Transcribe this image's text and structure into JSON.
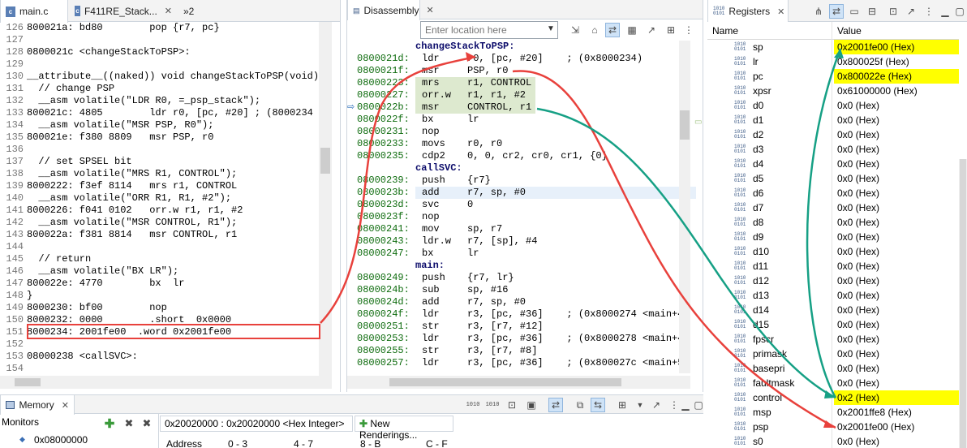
{
  "editor": {
    "tabs": [
      {
        "label": "main.c",
        "icon": "c-file-icon"
      },
      {
        "label": "F411RE_Stack...",
        "icon": "c-file-icon"
      },
      {
        "label": "»2",
        "icon": "more-tabs-icon"
      }
    ],
    "lines": [
      {
        "num": "126",
        "text": "800021a: bd80        pop {r7, pc}"
      },
      {
        "num": "127",
        "text": ""
      },
      {
        "num": "128",
        "text": "0800021c <changeStackToPSP>:"
      },
      {
        "num": "129",
        "text": ""
      },
      {
        "num": "130",
        "text": "__attribute__((naked)) void changeStackToPSP(void)"
      },
      {
        "num": "131",
        "text": "  // change PSP"
      },
      {
        "num": "132",
        "text": "  __asm volatile(\"LDR R0, =_psp_stack\");"
      },
      {
        "num": "133",
        "text": "800021c: 4805        ldr r0, [pc, #20] ; (8000234"
      },
      {
        "num": "134",
        "text": "  __asm volatile(\"MSR PSP, R0\");"
      },
      {
        "num": "135",
        "text": "800021e: f380 8809   msr PSP, r0"
      },
      {
        "num": "136",
        "text": ""
      },
      {
        "num": "137",
        "text": "  // set SPSEL bit"
      },
      {
        "num": "138",
        "text": "  __asm volatile(\"MRS R1, CONTROL\");"
      },
      {
        "num": "139",
        "text": "8000222: f3ef 8114   mrs r1, CONTROL"
      },
      {
        "num": "140",
        "text": "  __asm volatile(\"ORR R1, R1, #2\");"
      },
      {
        "num": "141",
        "text": "8000226: f041 0102   orr.w r1, r1, #2"
      },
      {
        "num": "142",
        "text": "  __asm volatile(\"MSR CONTROL, R1\");"
      },
      {
        "num": "143",
        "text": "800022a: f381 8814   msr CONTROL, r1"
      },
      {
        "num": "144",
        "text": ""
      },
      {
        "num": "145",
        "text": "  // return"
      },
      {
        "num": "146",
        "text": "  __asm volatile(\"BX LR\");"
      },
      {
        "num": "147",
        "text": "800022e: 4770        bx  lr"
      },
      {
        "num": "148",
        "text": "}"
      },
      {
        "num": "149",
        "text": "8000230: bf00        nop"
      },
      {
        "num": "150",
        "text": "8000232: 0000        .short  0x0000"
      },
      {
        "num": "151",
        "text": "8000234: 2001fe00  .word 0x2001fe00"
      },
      {
        "num": "152",
        "text": ""
      },
      {
        "num": "153",
        "text": "08000238 <callSVC>:"
      },
      {
        "num": "154",
        "text": ""
      }
    ]
  },
  "disassembly": {
    "tab_label": "Disassembly",
    "location_placeholder": "Enter location here",
    "lines": [
      {
        "addr": "",
        "label": "changeStackToPSP:",
        "ins": "",
        "ops": ""
      },
      {
        "addr": "0800021d:",
        "ins": "ldr",
        "ops": "r0, [pc, #20]    ; (0x8000234)"
      },
      {
        "addr": "0800021f:",
        "ins": "msr",
        "ops": "PSP, r0"
      },
      {
        "addr": "08000223:",
        "ins": "mrs",
        "ops": "r1, CONTROL"
      },
      {
        "addr": "08000227:",
        "ins": "orr.w",
        "ops": "r1, r1, #2"
      },
      {
        "addr": "0800022b:",
        "ins": "msr",
        "ops": "CONTROL, r1"
      },
      {
        "addr": "0800022f:",
        "ins": "bx",
        "ops": "lr"
      },
      {
        "addr": "08000231:",
        "ins": "nop",
        "ops": ""
      },
      {
        "addr": "08000233:",
        "ins": "movs",
        "ops": "r0, r0"
      },
      {
        "addr": "08000235:",
        "ins": "cdp2",
        "ops": "0, 0, cr2, cr0, cr1, {0}"
      },
      {
        "addr": "",
        "label": "callSVC:",
        "ins": "",
        "ops": ""
      },
      {
        "addr": "08000239:",
        "ins": "push",
        "ops": "{r7}"
      },
      {
        "addr": "0800023b:",
        "ins": "add",
        "ops": "r7, sp, #0"
      },
      {
        "addr": "0800023d:",
        "ins": "svc",
        "ops": "0"
      },
      {
        "addr": "0800023f:",
        "ins": "nop",
        "ops": ""
      },
      {
        "addr": "08000241:",
        "ins": "mov",
        "ops": "sp, r7"
      },
      {
        "addr": "08000243:",
        "ins": "ldr.w",
        "ops": "r7, [sp], #4"
      },
      {
        "addr": "08000247:",
        "ins": "bx",
        "ops": "lr"
      },
      {
        "addr": "",
        "label": "main:",
        "ins": "",
        "ops": ""
      },
      {
        "addr": "08000249:",
        "ins": "push",
        "ops": "{r7, lr}"
      },
      {
        "addr": "0800024b:",
        "ins": "sub",
        "ops": "sp, #16"
      },
      {
        "addr": "0800024d:",
        "ins": "add",
        "ops": "r7, sp, #0"
      },
      {
        "addr": "0800024f:",
        "ins": "ldr",
        "ops": "r3, [pc, #36]    ; (0x8000274 <main+4"
      },
      {
        "addr": "08000251:",
        "ins": "str",
        "ops": "r3, [r7, #12]"
      },
      {
        "addr": "08000253:",
        "ins": "ldr",
        "ops": "r3, [pc, #36]    ; (0x8000278 <main+4"
      },
      {
        "addr": "08000255:",
        "ins": "str",
        "ops": "r3, [r7, #8]"
      },
      {
        "addr": "08000257:",
        "ins": "ldr",
        "ops": "r3, [pc, #36]    ; (0x800027c <main+5"
      }
    ]
  },
  "registers": {
    "tab_label": "Registers",
    "col_name": "Name",
    "col_value": "Value",
    "rows": [
      {
        "name": "sp",
        "value": "0x2001fe00 (Hex)",
        "highlight": true
      },
      {
        "name": "lr",
        "value": "0x800025f (Hex)",
        "highlight": false
      },
      {
        "name": "pc",
        "value": "0x800022e (Hex)",
        "highlight": true
      },
      {
        "name": "xpsr",
        "value": "0x61000000 (Hex)",
        "highlight": false
      },
      {
        "name": "d0",
        "value": "0x0 (Hex)",
        "highlight": false
      },
      {
        "name": "d1",
        "value": "0x0 (Hex)",
        "highlight": false
      },
      {
        "name": "d2",
        "value": "0x0 (Hex)",
        "highlight": false
      },
      {
        "name": "d3",
        "value": "0x0 (Hex)",
        "highlight": false
      },
      {
        "name": "d4",
        "value": "0x0 (Hex)",
        "highlight": false
      },
      {
        "name": "d5",
        "value": "0x0 (Hex)",
        "highlight": false
      },
      {
        "name": "d6",
        "value": "0x0 (Hex)",
        "highlight": false
      },
      {
        "name": "d7",
        "value": "0x0 (Hex)",
        "highlight": false
      },
      {
        "name": "d8",
        "value": "0x0 (Hex)",
        "highlight": false
      },
      {
        "name": "d9",
        "value": "0x0 (Hex)",
        "highlight": false
      },
      {
        "name": "d10",
        "value": "0x0 (Hex)",
        "highlight": false
      },
      {
        "name": "d11",
        "value": "0x0 (Hex)",
        "highlight": false
      },
      {
        "name": "d12",
        "value": "0x0 (Hex)",
        "highlight": false
      },
      {
        "name": "d13",
        "value": "0x0 (Hex)",
        "highlight": false
      },
      {
        "name": "d14",
        "value": "0x0 (Hex)",
        "highlight": false
      },
      {
        "name": "d15",
        "value": "0x0 (Hex)",
        "highlight": false
      },
      {
        "name": "fpscr",
        "value": "0x0 (Hex)",
        "highlight": false
      },
      {
        "name": "primask",
        "value": "0x0 (Hex)",
        "highlight": false
      },
      {
        "name": "basepri",
        "value": "0x0 (Hex)",
        "highlight": false
      },
      {
        "name": "faultmask",
        "value": "0x0 (Hex)",
        "highlight": false
      },
      {
        "name": "control",
        "value": "0x2 (Hex)",
        "highlight": true
      },
      {
        "name": "msp",
        "value": "0x2001ffe8 (Hex)",
        "highlight": false
      },
      {
        "name": "psp",
        "value": "0x2001fe00 (Hex)",
        "highlight": false
      },
      {
        "name": "s0",
        "value": "0x0 (Hex)",
        "highlight": false
      }
    ]
  },
  "memory": {
    "tab_label": "Memory",
    "monitors_label": "Monitors",
    "monitor_entry": "0x08000000",
    "rendering_tab": "0x20020000 : 0x20020000 <Hex Integer>",
    "new_renderings_label": "New Renderings...",
    "columns": [
      "Address",
      "0 - 3",
      "4 - 7",
      "8 - B",
      "C - F"
    ]
  },
  "colors": {
    "annotation_red": "#e8413c",
    "annotation_green": "#16a085",
    "register_highlight": "#ffff00",
    "current_line_green": "#dde9cf"
  }
}
